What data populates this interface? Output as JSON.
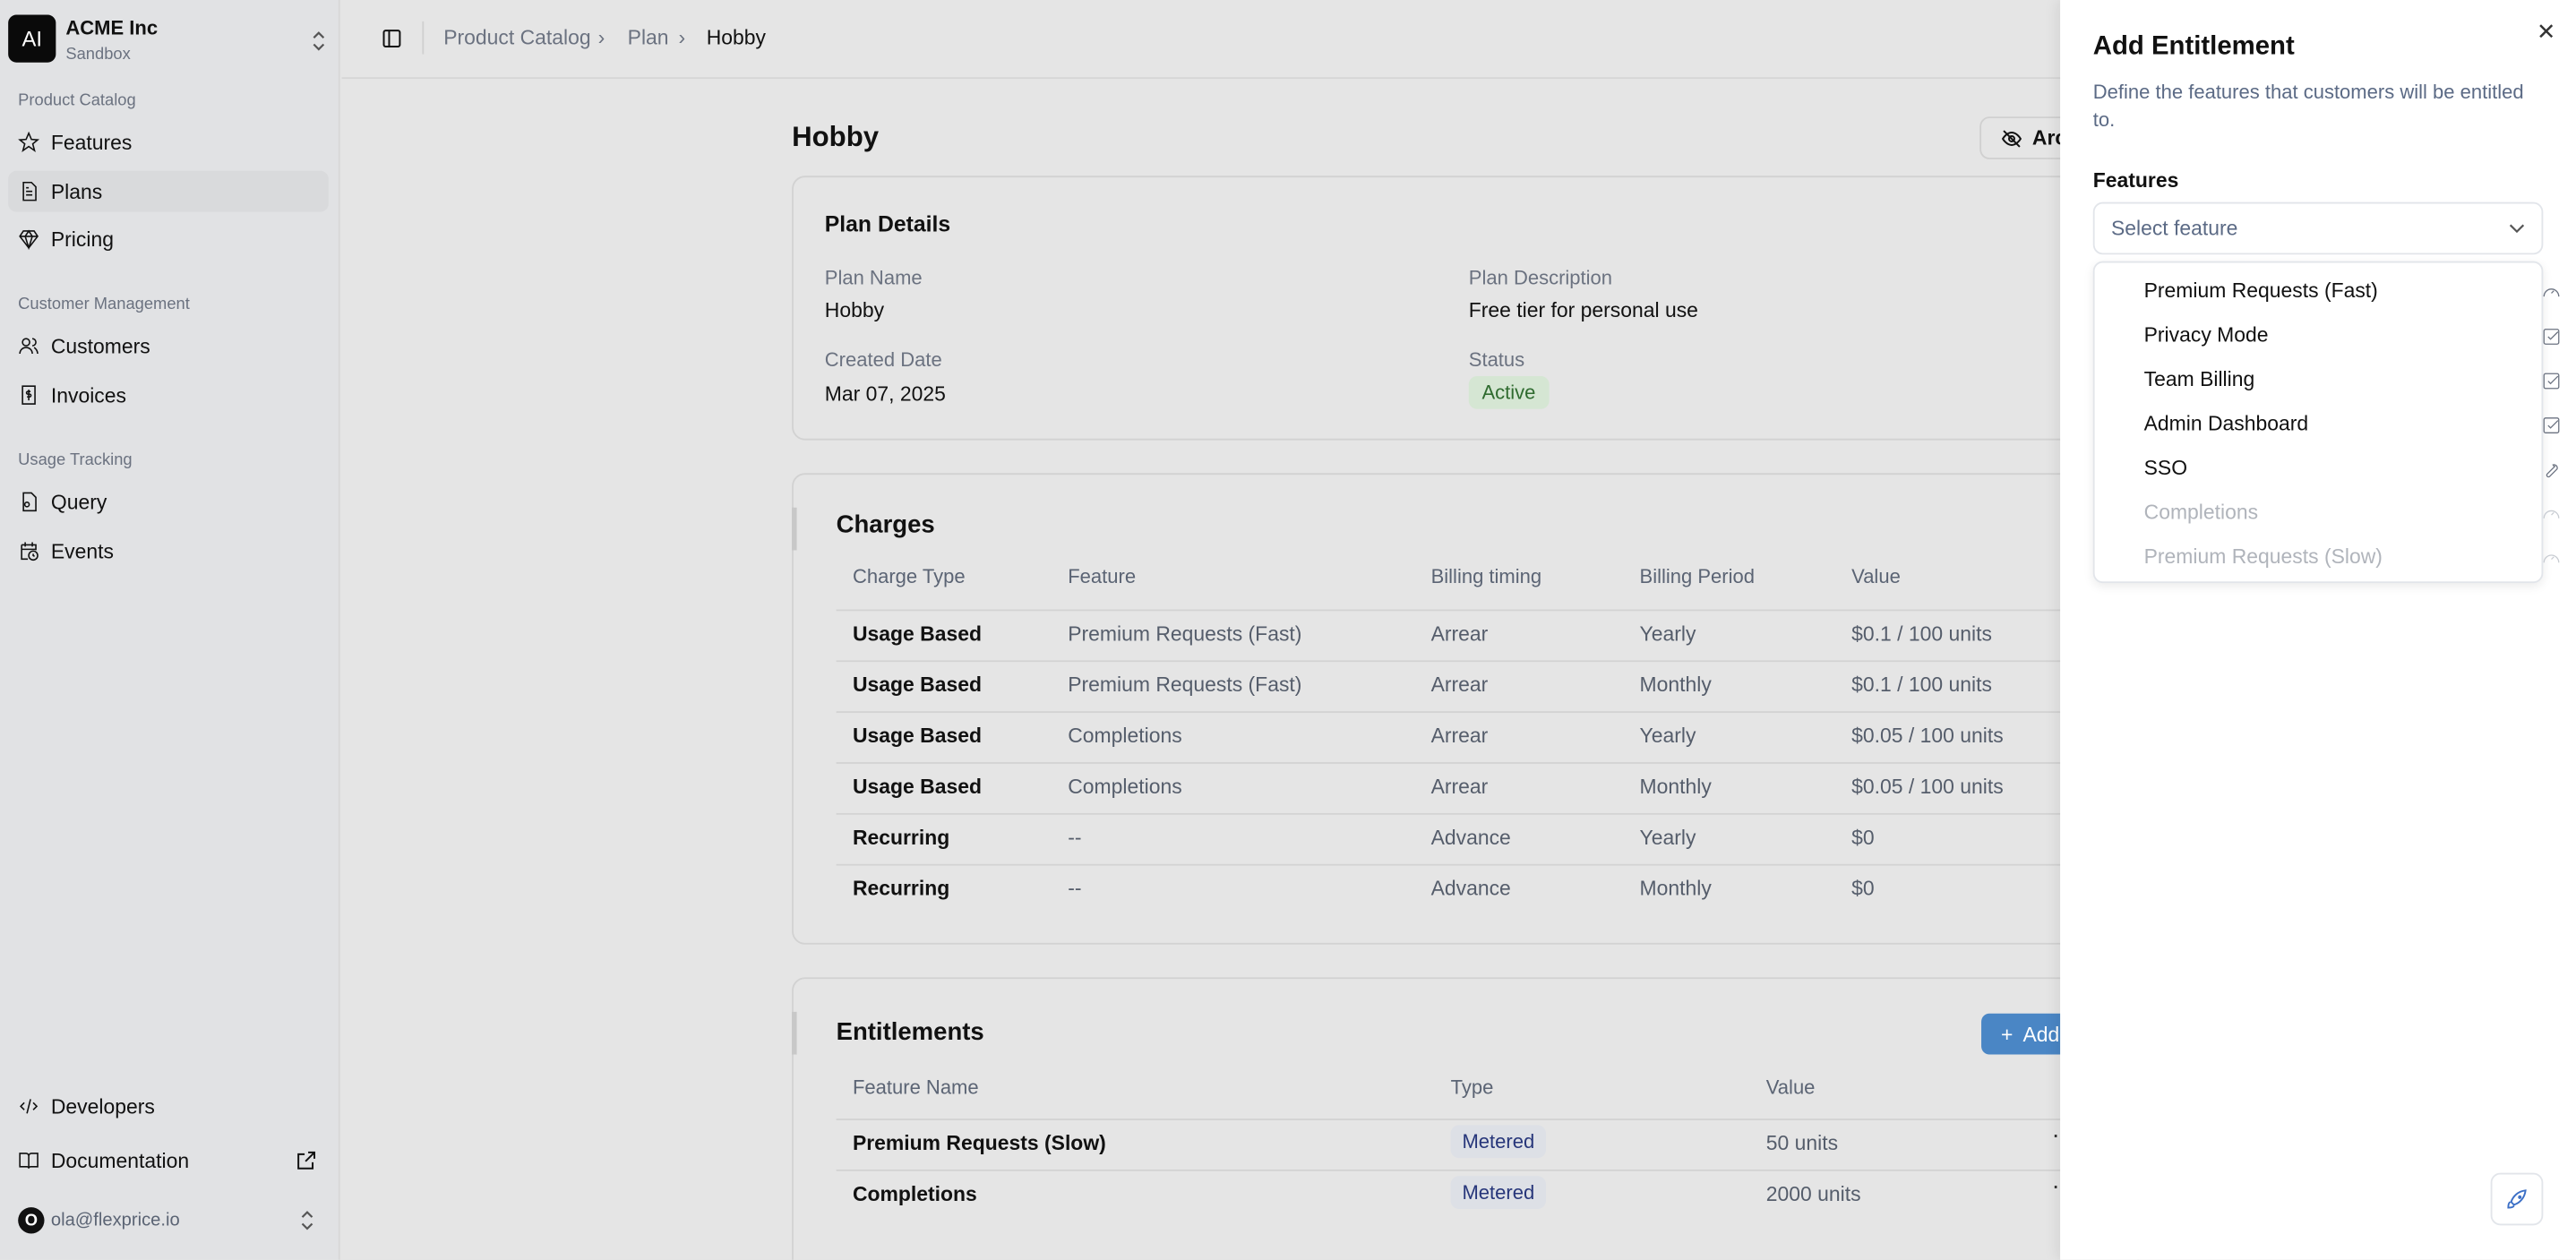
{
  "sidebar": {
    "org_initials": "AI",
    "org_name": "ACME Inc",
    "env": "Sandbox",
    "sections": [
      {
        "title": "Product Catalog",
        "items": [
          "Features",
          "Plans",
          "Pricing"
        ]
      },
      {
        "title": "Customer Management",
        "items": [
          "Customers",
          "Invoices"
        ]
      },
      {
        "title": "Usage Tracking",
        "items": [
          "Query",
          "Events"
        ]
      }
    ],
    "footer": {
      "developers": "Developers",
      "documentation": "Documentation",
      "user_initial": "O",
      "user_email": "ola@flexprice.io"
    }
  },
  "breadcrumb": [
    "Product Catalog",
    "Plan",
    "Hobby"
  ],
  "page": {
    "title": "Hobby",
    "archive_label": "Archive"
  },
  "plan_details": {
    "title": "Plan Details",
    "name_label": "Plan Name",
    "name": "Hobby",
    "desc_label": "Plan Description",
    "desc": "Free tier for personal use",
    "created_label": "Created Date",
    "created": "Mar 07, 2025",
    "status_label": "Status",
    "status": "Active"
  },
  "charges": {
    "title": "Charges",
    "headers": [
      "Charge Type",
      "Feature",
      "Billing timing",
      "Billing Period",
      "Value"
    ],
    "rows": [
      [
        "Usage Based",
        "Premium Requests (Fast)",
        "Arrear",
        "Yearly",
        "$0.1 / 100 units"
      ],
      [
        "Usage Based",
        "Premium Requests (Fast)",
        "Arrear",
        "Monthly",
        "$0.1 / 100 units"
      ],
      [
        "Usage Based",
        "Completions",
        "Arrear",
        "Yearly",
        "$0.05 / 100 units"
      ],
      [
        "Usage Based",
        "Completions",
        "Arrear",
        "Monthly",
        "$0.05 / 100 units"
      ],
      [
        "Recurring",
        "--",
        "Advance",
        "Yearly",
        "$0"
      ],
      [
        "Recurring",
        "--",
        "Advance",
        "Monthly",
        "$0"
      ]
    ]
  },
  "entitlements": {
    "title": "Entitlements",
    "add_label": "Add",
    "headers": [
      "Feature Name",
      "Type",
      "Value"
    ],
    "rows": [
      [
        "Premium Requests (Slow)",
        "Metered",
        "50 units"
      ],
      [
        "Completions",
        "Metered",
        "2000 units"
      ]
    ]
  },
  "sheet": {
    "title": "Add Entitlement",
    "description": "Define the features that customers will be entitled to.",
    "features_label": "Features",
    "select_placeholder": "Select feature",
    "options": [
      {
        "label": "Premium Requests (Fast)",
        "icon": "gauge-icon",
        "disabled": false
      },
      {
        "label": "Privacy Mode",
        "icon": "checkbox-icon",
        "disabled": false
      },
      {
        "label": "Team Billing",
        "icon": "checkbox-icon",
        "disabled": false
      },
      {
        "label": "Admin Dashboard",
        "icon": "checkbox-icon",
        "disabled": false
      },
      {
        "label": "SSO",
        "icon": "wrench-icon",
        "disabled": false
      },
      {
        "label": "Completions",
        "icon": "gauge-icon",
        "disabled": true
      },
      {
        "label": "Premium Requests (Slow)",
        "icon": "gauge-icon",
        "disabled": true
      }
    ]
  }
}
